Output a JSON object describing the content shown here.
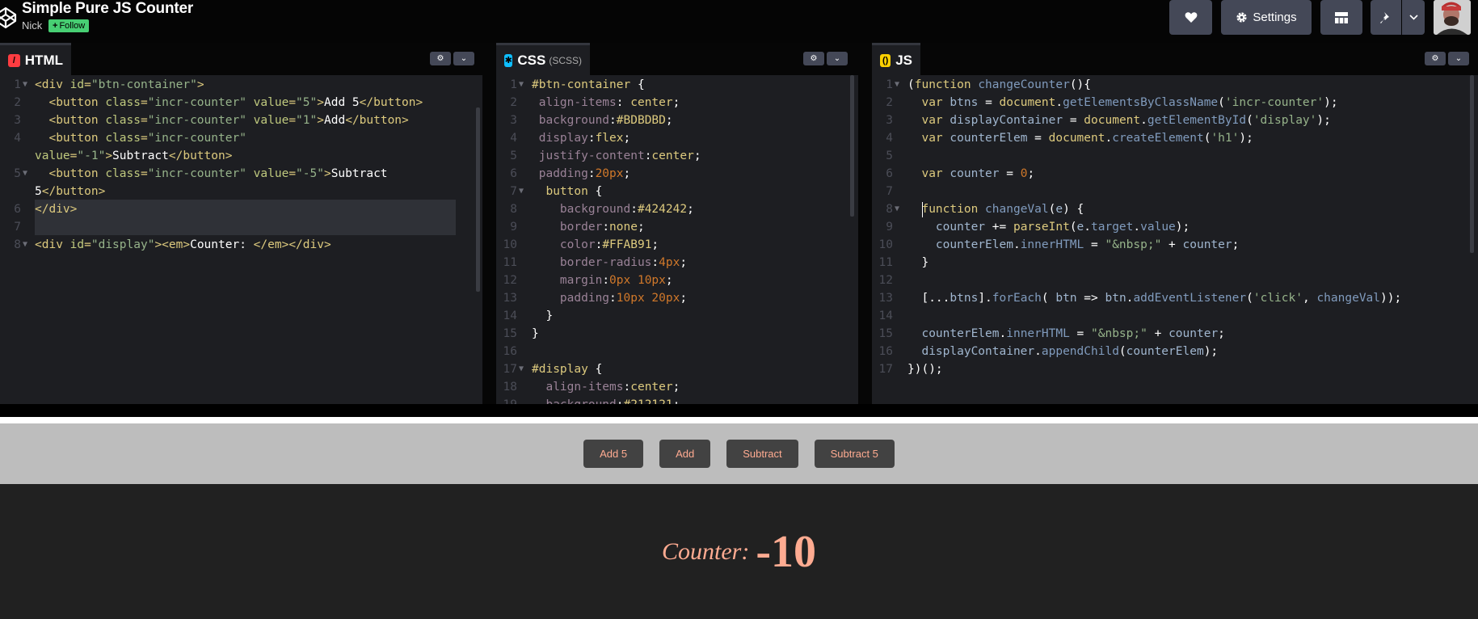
{
  "header": {
    "title": "Simple Pure JS Counter",
    "author": "Nick",
    "follow_label": "Follow",
    "settings_label": "Settings"
  },
  "icons": [
    "codepen-logo-icon",
    "heart-icon",
    "gear-icon",
    "layout-grid-icon",
    "pin-icon",
    "chevron-down-icon",
    "settings-gear-icon"
  ],
  "editors": {
    "html": {
      "tab_label": "HTML",
      "tab_sub": "",
      "lines": [
        "1",
        "2",
        "3",
        "4",
        "",
        "5",
        "",
        "6",
        "7",
        "8"
      ]
    },
    "css": {
      "tab_label": "CSS",
      "tab_sub": "(SCSS)"
    },
    "js": {
      "tab_label": "JS",
      "tab_sub": ""
    }
  },
  "preview": {
    "buttons": [
      "Add 5",
      "Add",
      "Subtract",
      "Subtract 5"
    ],
    "counter_label": "Counter:",
    "counter_value": "-10"
  },
  "colors": {
    "accent_follow": "#47cf73",
    "editor_bg": "#1d1e22",
    "button_bg": "#424242",
    "button_text": "#ffab91",
    "container_bg": "#bdbdbd"
  }
}
